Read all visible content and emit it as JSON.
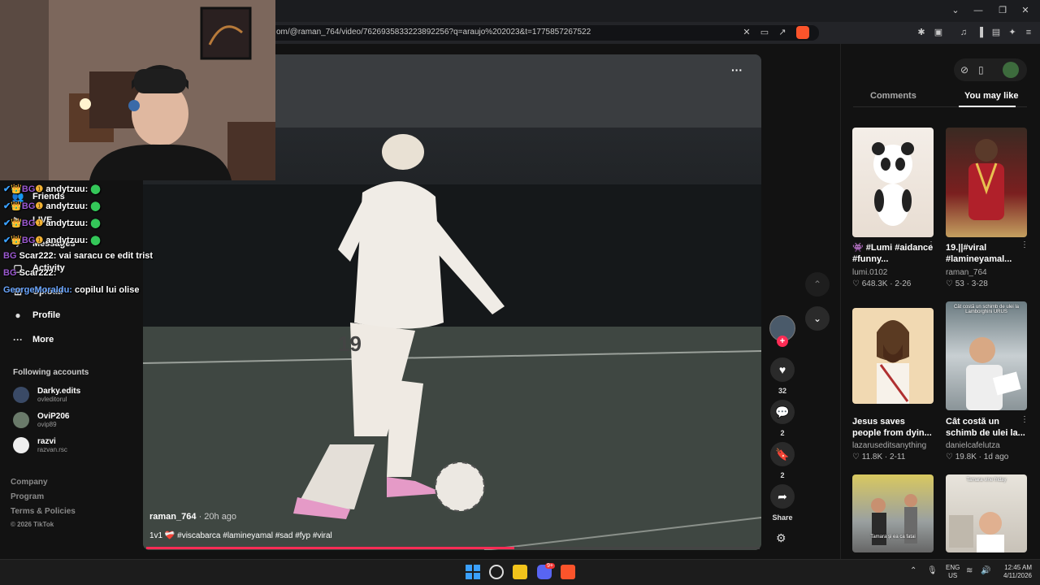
{
  "browser": {
    "url": "om/@raman_764/video/7626935833223892256?q=araujo%202023&t=1775857267522",
    "window_controls": {
      "chevron": "⌄",
      "minimize": "—",
      "restore": "❐",
      "close": "✕"
    }
  },
  "sidebar": {
    "nav": [
      {
        "label": "Friends",
        "icon": "friends-icon"
      },
      {
        "label": "LIVE",
        "icon": "live-icon"
      },
      {
        "label": "Messages",
        "icon": "messages-icon"
      },
      {
        "label": "Activity",
        "icon": "activity-icon"
      },
      {
        "label": "Upload",
        "icon": "upload-icon"
      },
      {
        "label": "Profile",
        "icon": "profile-icon"
      },
      {
        "label": "More",
        "icon": "more-icon"
      }
    ],
    "following_title": "Following accounts",
    "following": [
      {
        "name": "Darky.edits",
        "handle": "ovleditorul"
      },
      {
        "name": "OviP206",
        "handle": "ovip89"
      },
      {
        "name": "razvi",
        "handle": "razvan.rsc"
      }
    ],
    "footer": [
      "Company",
      "Program",
      "Terms & Policies",
      "© 2026 TikTok"
    ]
  },
  "chat": [
    {
      "user": "andytzuu:",
      "msg": ""
    },
    {
      "user": "andytzuu:",
      "msg": ""
    },
    {
      "user": "andytzuu:",
      "msg": ""
    },
    {
      "user": "andytzuu:",
      "msg": ""
    },
    {
      "user": "Scar222:",
      "msg": "vai saracu ce edit trist"
    },
    {
      "user": "Scar222:",
      "msg": ""
    },
    {
      "user": "GeorgeMoraldu:",
      "msg": "copilul lui olise"
    }
  ],
  "video": {
    "author": "raman_764",
    "time": "· 20h ago",
    "caption": "1v1 ❤️‍🩹 #viscabarca #lamineyamal #sad #fyp #viral",
    "progress": 0.6,
    "more": "···"
  },
  "actions": {
    "likes": "32",
    "comments": "2",
    "saves": "2",
    "share": "Share"
  },
  "right_panel": {
    "tabs": {
      "comments": "Comments",
      "you_may_like": "You may like"
    },
    "cards": [
      {
        "title": "👾 #Lumi #aidance #funny...",
        "author": "lumi.0102",
        "meta": "♡ 648.3K · 2-26"
      },
      {
        "title": "19.||#viral #lamineyamal...",
        "author": "raman_764",
        "meta": "♡ 53 · 3-28"
      },
      {
        "title": "Jesus saves people from dyin...",
        "author": "lazaruseditsanything",
        "meta": "♡ 11.8K · 2-11"
      },
      {
        "title": "Cât costă un schimb de ulei la...",
        "author": "danielcafelutza",
        "meta": "♡ 19.8K · 1d ago"
      }
    ],
    "thumb_text": {
      "c4": "Cât costă un schimb de ulei la Lamborghini URUS",
      "c5": "Tamara și ea ca fatai",
      "c6": "Tamara vine friday"
    }
  },
  "taskbar": {
    "lang": "ENG",
    "region": "US",
    "time": "12:45 AM",
    "date": "4/11/2026",
    "badge": "9+"
  },
  "colors": {
    "accent": "#fe2c55",
    "bg": "#121212"
  }
}
